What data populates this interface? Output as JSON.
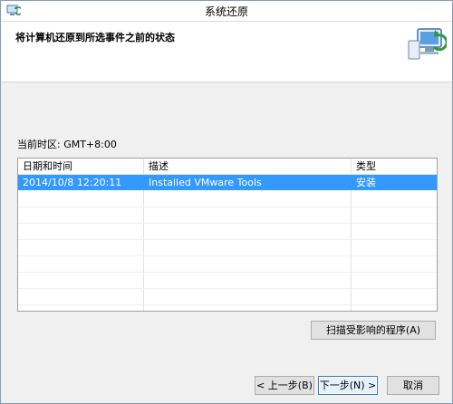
{
  "window": {
    "title": "系统还原"
  },
  "header": {
    "title": "将计算机还原到所选事件之前的状态",
    "icon": "system-restore-icon"
  },
  "timezone_label": "当前时区: GMT+8:00",
  "table": {
    "columns": [
      "日期和时间",
      "描述",
      "类型"
    ],
    "rows": [
      {
        "datetime": "2014/10/8 12:20:11",
        "description": "Installed VMware Tools",
        "type": "安装",
        "selected": true
      }
    ]
  },
  "buttons": {
    "scan": "扫描受影响的程序(A)",
    "back": "< 上一步(B)",
    "next": "下一步(N) >",
    "cancel": "取消"
  },
  "colors": {
    "selection": "#3399ff",
    "focus_border": "#3c7fb1"
  }
}
